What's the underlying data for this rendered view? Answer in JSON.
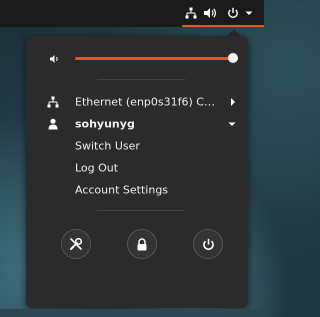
{
  "topbar": {
    "icons": [
      "network-wired-icon",
      "volume-icon",
      "power-icon",
      "chevron-down-icon"
    ],
    "accent_color": "#e95420"
  },
  "volume": {
    "level_percent": 100,
    "icon": "speaker-icon"
  },
  "network": {
    "label": "Ethernet (enp0s31f6) C…",
    "icon": "network-wired-icon"
  },
  "user": {
    "name": "sohyunyg",
    "icon": "user-icon",
    "items": [
      {
        "label": "Switch User"
      },
      {
        "label": "Log Out"
      },
      {
        "label": "Account Settings"
      }
    ]
  },
  "actions": [
    {
      "icon": "settings-tools-icon"
    },
    {
      "icon": "lock-icon"
    },
    {
      "icon": "power-icon"
    }
  ],
  "colors": {
    "menu_bg": "#2b2b2b",
    "accent": "#e95420",
    "text": "#eeeeee"
  }
}
